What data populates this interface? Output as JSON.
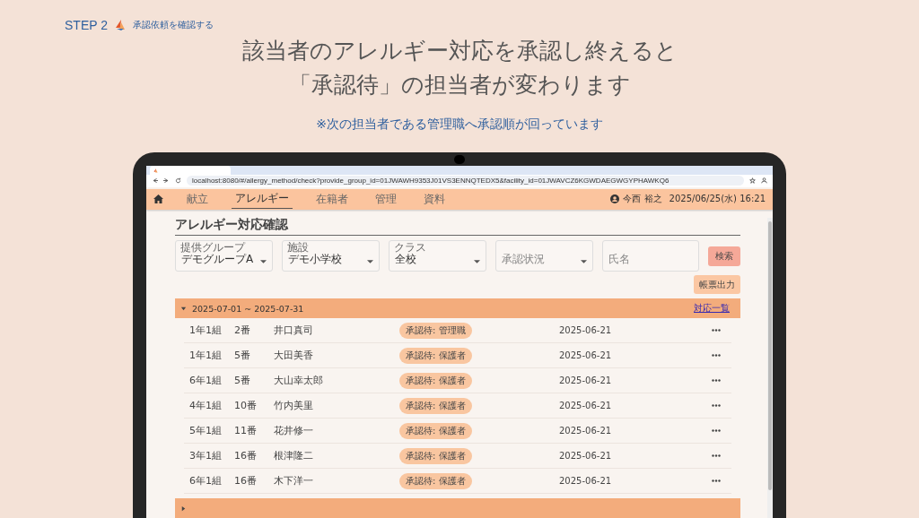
{
  "step": {
    "label": "STEP 2",
    "title": "承認依頼を確認する"
  },
  "headline": [
    "該当者のアレルギー対応を承認し終えると",
    "「承認待」の担当者が変わります"
  ],
  "note": "※次の担当者である管理職へ承認順が回っています",
  "browser": {
    "url": "localhost:8080/#/allergy_method/check?provide_group_id=01JWAWH9353J01VS3ENNQTEDX5&facility_id=01JWAVCZ6KGWDAEGWGYPHAWKQ6"
  },
  "nav": {
    "items": [
      {
        "label": "献立",
        "selected": false
      },
      {
        "label": "アレルギー",
        "selected": true
      },
      {
        "label": "在籍者",
        "selected": false
      },
      {
        "label": "管理",
        "selected": false
      },
      {
        "label": "資料",
        "selected": false
      }
    ],
    "user": "今西 裕之",
    "datetime": "2025/06/25(水) 16:21"
  },
  "page_title": "アレルギー対応確認",
  "filters": [
    {
      "kind": "select",
      "label": "提供グループ",
      "value": "デモグループA"
    },
    {
      "kind": "select",
      "label": "施設",
      "value": "デモ小学校"
    },
    {
      "kind": "select",
      "label": "クラス",
      "value": "全校"
    },
    {
      "kind": "select",
      "placeholder": "承認状況"
    },
    {
      "kind": "text",
      "placeholder": "氏名"
    }
  ],
  "search_button": "検索",
  "export_button": "帳票出力",
  "groups": [
    {
      "period": "2025-07-01 ~ 2025-07-31",
      "link": "対応一覧",
      "expanded": true,
      "rows": [
        {
          "class": "1年1組",
          "number": "2番",
          "name": "井口真司",
          "status": "承認待: 管理職",
          "date": "2025-06-21"
        },
        {
          "class": "1年1組",
          "number": "5番",
          "name": "大田美香",
          "status": "承認待: 保護者",
          "date": "2025-06-21"
        },
        {
          "class": "6年1組",
          "number": "5番",
          "name": "大山幸太郎",
          "status": "承認待: 保護者",
          "date": "2025-06-21"
        },
        {
          "class": "4年1組",
          "number": "10番",
          "name": "竹内美里",
          "status": "承認待: 保護者",
          "date": "2025-06-21"
        },
        {
          "class": "5年1組",
          "number": "11番",
          "name": "花井修一",
          "status": "承認待: 保護者",
          "date": "2025-06-21"
        },
        {
          "class": "3年1組",
          "number": "16番",
          "name": "根津隆二",
          "status": "承認待: 保護者",
          "date": "2025-06-21"
        },
        {
          "class": "6年1組",
          "number": "16番",
          "name": "木下洋一",
          "status": "承認待: 保護者",
          "date": "2025-06-21"
        }
      ]
    },
    {
      "expanded": false
    }
  ]
}
